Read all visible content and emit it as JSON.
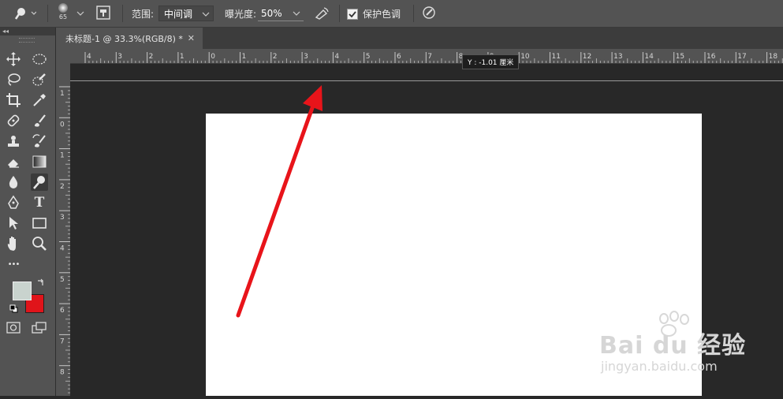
{
  "options_bar": {
    "brush_size": "65",
    "range_label": "范围:",
    "range_value": "中间调",
    "exposure_label": "曝光度:",
    "exposure_value": "50%",
    "protect_tones_label": "保护色调",
    "protect_tones_checked": true
  },
  "document_tab": {
    "title": "未标题-1 @ 33.3%(RGB/8) *",
    "close_glyph": "✕"
  },
  "ruler": {
    "top_labels": [
      "4",
      "3",
      "2",
      "1",
      "0",
      "1",
      "2",
      "3",
      "4",
      "5",
      "6",
      "7",
      "8",
      "9",
      "10",
      "11",
      "12",
      "13",
      "14",
      "15",
      "16",
      "17",
      "18"
    ],
    "left_labels": [
      "1",
      "0",
      "1",
      "2",
      "3",
      "4",
      "5",
      "6",
      "7",
      "8"
    ]
  },
  "tooltip": {
    "text": "Y : -1.01 厘米"
  },
  "toolbar": {
    "tools": [
      {
        "name": "move-tool",
        "icon": "move-icon"
      },
      {
        "name": "marquee-tool",
        "icon": "ellipse-marquee-icon"
      },
      {
        "name": "lasso-tool",
        "icon": "lasso-icon"
      },
      {
        "name": "quick-select-tool",
        "icon": "quick-select-icon"
      },
      {
        "name": "crop-tool",
        "icon": "crop-icon"
      },
      {
        "name": "eyedropper-tool",
        "icon": "eyedropper-icon"
      },
      {
        "name": "healing-tool",
        "icon": "bandage-icon"
      },
      {
        "name": "brush-tool",
        "icon": "brush-icon"
      },
      {
        "name": "stamp-tool",
        "icon": "stamp-icon"
      },
      {
        "name": "history-brush-tool",
        "icon": "history-brush-icon"
      },
      {
        "name": "eraser-tool",
        "icon": "eraser-icon"
      },
      {
        "name": "gradient-tool",
        "icon": "gradient-icon"
      },
      {
        "name": "blur-tool",
        "icon": "drop-icon"
      },
      {
        "name": "dodge-tool",
        "icon": "dodge-icon"
      },
      {
        "name": "pen-tool",
        "icon": "pen-icon"
      },
      {
        "name": "type-tool",
        "icon": "type-icon"
      },
      {
        "name": "path-select-tool",
        "icon": "arrow-icon"
      },
      {
        "name": "shape-tool",
        "icon": "rectangle-icon"
      },
      {
        "name": "hand-tool",
        "icon": "hand-icon"
      },
      {
        "name": "zoom-tool",
        "icon": "zoom-icon"
      },
      {
        "name": "more-tools",
        "icon": "ellipsis-icon"
      }
    ],
    "type_glyph": "T",
    "more_glyph": "•••",
    "foreground_color": "#c9d3ce",
    "background_color": "#e0141a"
  },
  "watermark": {
    "brand": "Bai du 经验",
    "url": "jingyan.baidu.com"
  },
  "colors": {
    "arrow": "#e8141a",
    "document": "#ffffff",
    "pasteboard": "#282828"
  }
}
